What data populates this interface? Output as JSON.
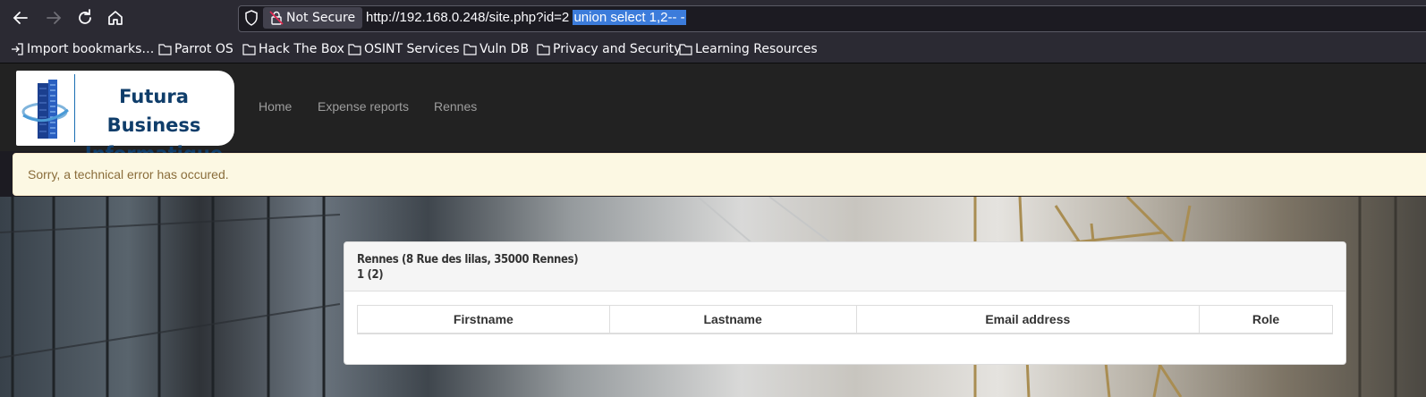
{
  "browser": {
    "security_label": "Not Secure",
    "url_base": "http://192.168.0.248/site.php?id=2 ",
    "url_selected": "union select 1,2-- -",
    "bookmarks": [
      {
        "label": "Import bookmarks…",
        "icon": "import-icon"
      },
      {
        "label": "Parrot OS",
        "icon": "folder-icon"
      },
      {
        "label": "Hack The Box",
        "icon": "folder-icon"
      },
      {
        "label": "OSINT Services",
        "icon": "folder-icon"
      },
      {
        "label": "Vuln DB",
        "icon": "folder-icon"
      },
      {
        "label": "Privacy and Security",
        "icon": "folder-icon"
      },
      {
        "label": "Learning Resources",
        "icon": "folder-icon"
      }
    ]
  },
  "site": {
    "logo": {
      "line1": "Futura Business",
      "line2": "Informatique"
    },
    "nav": [
      "Home",
      "Expense reports",
      "Rennes"
    ],
    "alert": "Sorry, a technical error has occured.",
    "panel": {
      "title": "Rennes (8 Rue des lilas, 35000 Rennes)",
      "subtitle": "1 (2)",
      "columns": [
        "Firstname",
        "Lastname",
        "Email address",
        "Role"
      ]
    }
  },
  "colors": {
    "navbar_bg": "#222222",
    "alert_bg": "#fcf8e3",
    "alert_text": "#8a6d3b",
    "logo_blue": "#0f3d6a",
    "url_highlight": "#3c7cdb"
  }
}
